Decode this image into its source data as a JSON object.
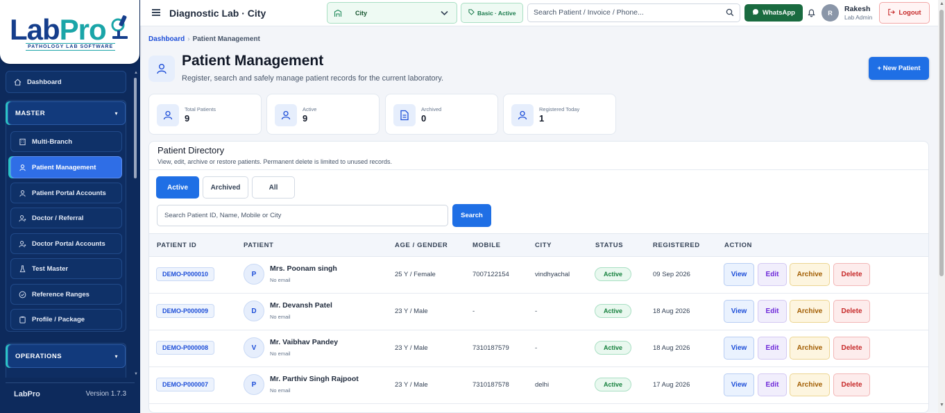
{
  "brand": {
    "logo_main": "LabPro",
    "logo_lab": "Lab",
    "logo_pro": "Pro",
    "tagline": "PATHOLOGY LAB SOFTWARE",
    "footer_name": "LabPro",
    "version": "Version 1.7.3"
  },
  "sidebar": {
    "dashboard": "Dashboard",
    "master_header": "MASTER",
    "master_items": [
      {
        "label": "Multi-Branch",
        "icon": "building-icon"
      },
      {
        "label": "Patient Management",
        "icon": "user-icon",
        "active": true
      },
      {
        "label": "Patient Portal Accounts",
        "icon": "user-icon"
      },
      {
        "label": "Doctor / Referral",
        "icon": "doctor-icon"
      },
      {
        "label": "Doctor Portal Accounts",
        "icon": "doctor-icon"
      },
      {
        "label": "Test Master",
        "icon": "flask-icon"
      },
      {
        "label": "Reference Ranges",
        "icon": "check-circle-icon"
      },
      {
        "label": "Profile / Package",
        "icon": "clipboard-icon"
      }
    ],
    "operations_header": "OPERATIONS"
  },
  "topbar": {
    "title": "Diagnostic Lab · City",
    "city": "City",
    "plan": "Basic · Active",
    "search_placeholder": "Search Patient / Invoice / Phone...",
    "whatsapp": "WhatsApp",
    "user_initial": "R",
    "user_name": "Rakesh",
    "user_role": "Lab Admin",
    "logout": "Logout"
  },
  "breadcrumb": {
    "root": "Dashboard",
    "separator": "›",
    "current": "Patient Management"
  },
  "page": {
    "title": "Patient Management",
    "subtitle": "Register, search and safely manage patient records for the current laboratory.",
    "new_button": "+ New Patient"
  },
  "stats": [
    {
      "label": "Total Patients",
      "value": "9",
      "icon": "user-icon"
    },
    {
      "label": "Active",
      "value": "9",
      "icon": "user-icon"
    },
    {
      "label": "Archived",
      "value": "0",
      "icon": "document-icon"
    },
    {
      "label": "Registered Today",
      "value": "1",
      "icon": "user-icon"
    }
  ],
  "directory": {
    "title": "Patient Directory",
    "subtitle": "View, edit, archive or restore patients. Permanent delete is limited to unused records.",
    "tabs": [
      "Active",
      "Archived",
      "All"
    ],
    "search_placeholder": "Search Patient ID, Name, Mobile or City",
    "search_button": "Search",
    "columns": [
      "PATIENT ID",
      "PATIENT",
      "AGE / GENDER",
      "MOBILE",
      "CITY",
      "STATUS",
      "REGISTERED",
      "ACTION"
    ],
    "actions": {
      "view": "View",
      "edit": "Edit",
      "archive": "Archive",
      "delete": "Delete"
    },
    "rows": [
      {
        "id": "DEMO-P000010",
        "initial": "P",
        "name": "Mrs. Poonam singh",
        "email": "No email",
        "age_gender": "25 Y / Female",
        "mobile": "7007122154",
        "city": "vindhyachal",
        "status": "Active",
        "registered": "09 Sep 2026"
      },
      {
        "id": "DEMO-P000009",
        "initial": "D",
        "name": "Mr. Devansh Patel",
        "email": "No email",
        "age_gender": "23 Y / Male",
        "mobile": "-",
        "city": "-",
        "status": "Active",
        "registered": "18 Aug 2026"
      },
      {
        "id": "DEMO-P000008",
        "initial": "V",
        "name": "Mr. Vaibhav Pandey",
        "email": "No email",
        "age_gender": "23 Y / Male",
        "mobile": "7310187579",
        "city": "-",
        "status": "Active",
        "registered": "18 Aug 2026"
      },
      {
        "id": "DEMO-P000007",
        "initial": "P",
        "name": "Mr. Parthiv Singh Rajpoot",
        "email": "No email",
        "age_gender": "23 Y / Male",
        "mobile": "7310187578",
        "city": "delhi",
        "status": "Active",
        "registered": "17 Aug 2026"
      }
    ]
  },
  "colors": {
    "sidebar_bg": "#0d2a5c",
    "accent_blue": "#1f6fe5",
    "accent_teal": "#2bc3c6",
    "success_green": "#15803d",
    "danger_red": "#c62828"
  }
}
